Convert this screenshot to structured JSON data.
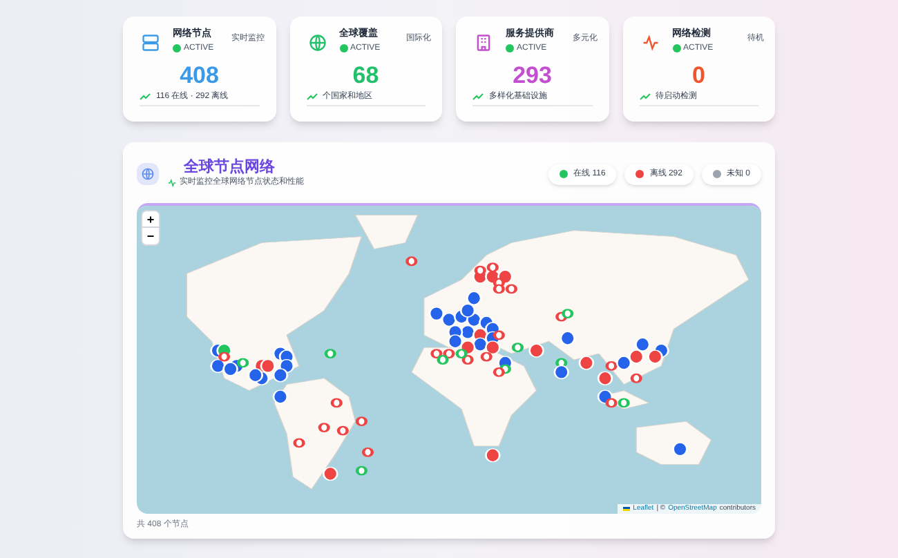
{
  "stats": [
    {
      "kind": "nodes",
      "title": "网络节点",
      "status": "ACTIVE",
      "tag": "实时监控",
      "value": "408",
      "color": "#3b9ae8",
      "note": "116 在线 · 292 离线"
    },
    {
      "kind": "globe",
      "title": "全球覆盖",
      "status": "ACTIVE",
      "tag": "国际化",
      "value": "68",
      "color": "#22c06a",
      "note": "个国家和地区"
    },
    {
      "kind": "provider",
      "title": "服务提供商",
      "status": "ACTIVE",
      "tag": "多元化",
      "value": "293",
      "color": "#c34fd0",
      "note": "多样化基础设施"
    },
    {
      "kind": "pulse",
      "title": "网络检测",
      "status": "ACTIVE",
      "tag": "待机",
      "value": "0",
      "color": "#f0562e",
      "note": "待启动检测"
    }
  ],
  "panel": {
    "title": "全球节点网络",
    "subtitle": "实时监控全球网络节点状态和性能",
    "legend": [
      {
        "label": "在线 116",
        "color": "#22c55e"
      },
      {
        "label": "离线 292",
        "color": "#ef4444"
      },
      {
        "label": "未知 0",
        "color": "#9ca3af"
      }
    ],
    "map": {
      "zoom_in": "+",
      "zoom_out": "−",
      "attribution_link": "Leaflet",
      "attribution_sep": "| ©",
      "attribution_osm": "OpenStreetMap",
      "attribution_rest": "contributors"
    },
    "footer": "共 408 个节点"
  }
}
